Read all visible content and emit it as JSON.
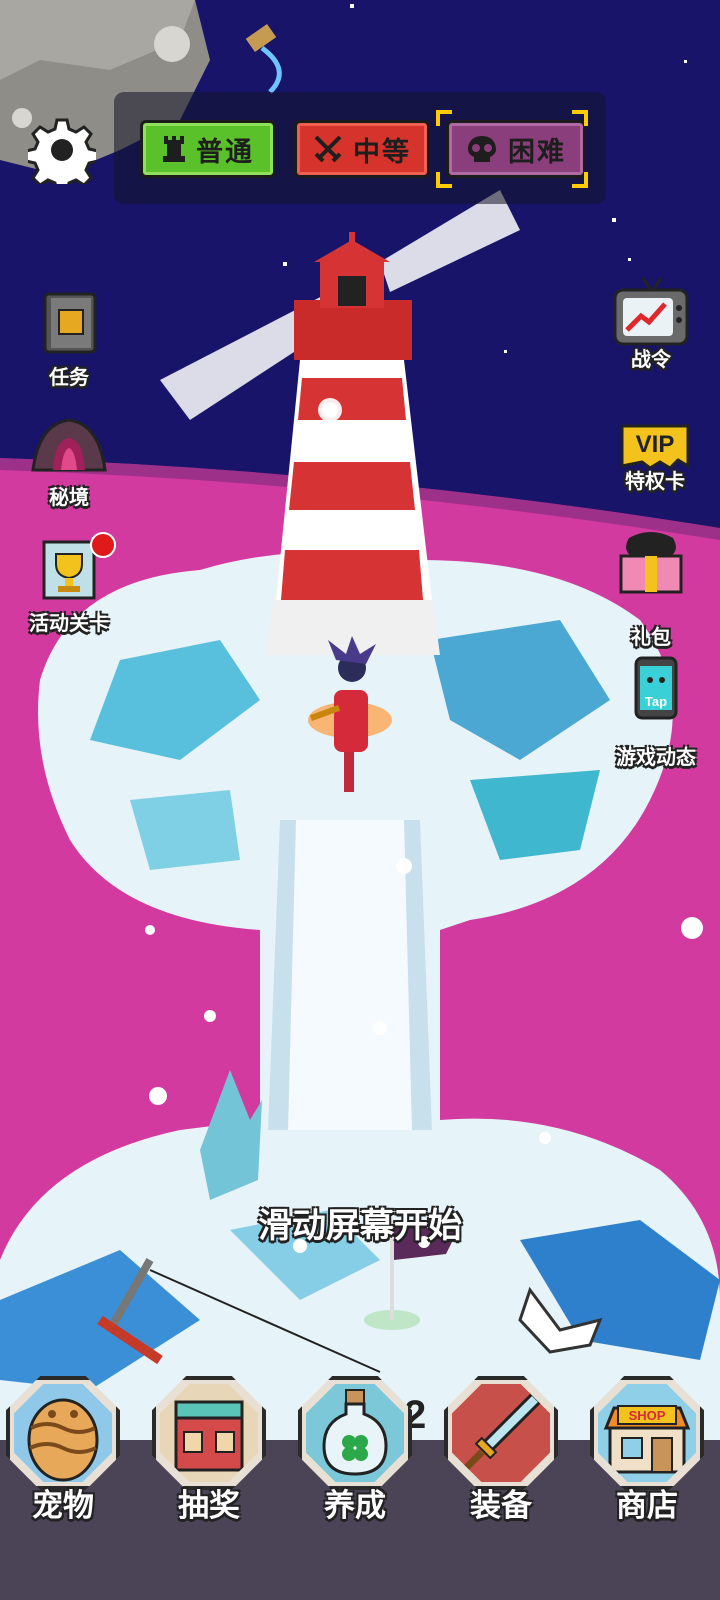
{
  "difficulty": {
    "options": [
      {
        "label": "普通",
        "color": "#5ac12a"
      },
      {
        "label": "中等",
        "color": "#d6332c"
      },
      {
        "label": "困难",
        "color": "#8a3e7c"
      }
    ],
    "selected": "困难"
  },
  "left_menu": {
    "quest": "任务",
    "secret_realm": "秘境",
    "event_levels": "活动关卡"
  },
  "right_menu": {
    "battle_pass": "战令",
    "vip_card": "特权卡",
    "vip_badge": "VIP",
    "gift_pack": "礼包",
    "game_news": "游戏动态",
    "tap_badge": "Tap"
  },
  "hint": "滑动屏幕开始",
  "level_number": "2",
  "bottom_nav": {
    "pet": "宠物",
    "lottery": "抽奖",
    "cultivate": "养成",
    "equipment": "装备",
    "shop": "商店",
    "shop_sign": "SHOP"
  },
  "colors": {
    "sky": "#1a1466",
    "sea": "#d23aa0",
    "ice": "#dff0f8",
    "accent_select": "#ffcc00"
  }
}
